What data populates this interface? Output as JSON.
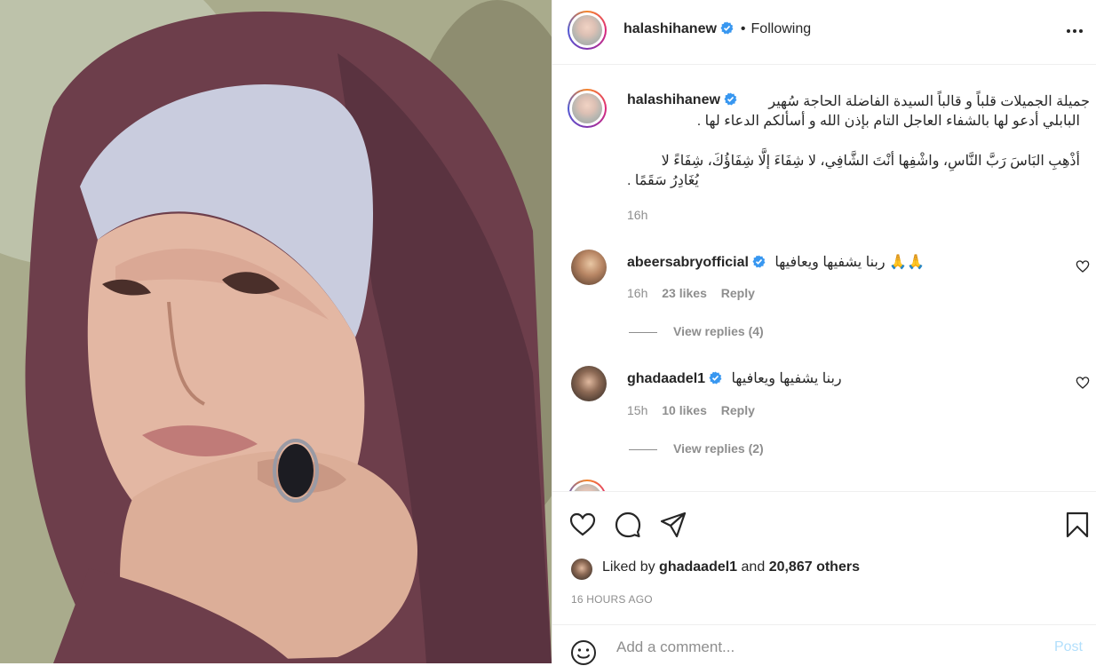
{
  "post": {
    "photo_alt_icon": "photo",
    "author": "halashihanew",
    "follow_status": "Following",
    "bullet": "•",
    "caption_line1": "جميلة الجميلات قلباً و قالباً السيدة الفاضلة الحاجة سُهير",
    "caption_line2": "البابلي أدعو لها بالشفاء العاجل التام بإذن الله و أسألكم الدعاء لها .",
    "caption_line3": "أذْهِبِ البَاسَ رَبَّ النَّاسِ، واشْفِها أنْتَ الشَّافِي، لا شِفَاءَ إلَّا شِفَاؤُكَ، شِفَاءً لا",
    "caption_line4": "يُغَادِرُ سَقَمًا .",
    "caption_time": "16h",
    "likes_prefix": "Liked by",
    "likes_user": "ghadaadel1",
    "likes_and": "and",
    "likes_others": "20,867 others",
    "date": "16 HOURS AGO"
  },
  "comments": [
    {
      "user": "abeersabryofficial",
      "text": "ربنا يشفيها ويعافيها 🙏🙏",
      "time": "16h",
      "likes": "23 likes",
      "reply": "Reply",
      "view_replies": "View replies (4)"
    },
    {
      "user": "ghadaadel1",
      "text": "ربنا يشفيها ويعافيها",
      "time": "15h",
      "likes": "10 likes",
      "reply": "Reply",
      "view_replies": "View replies (2)"
    }
  ],
  "comment_box": {
    "placeholder": "Add a comment...",
    "post_label": "Post"
  },
  "colors": {
    "verified": "#3897f0",
    "post_disabled": "#b2dffc",
    "meta_gray": "#8e8e8e"
  }
}
